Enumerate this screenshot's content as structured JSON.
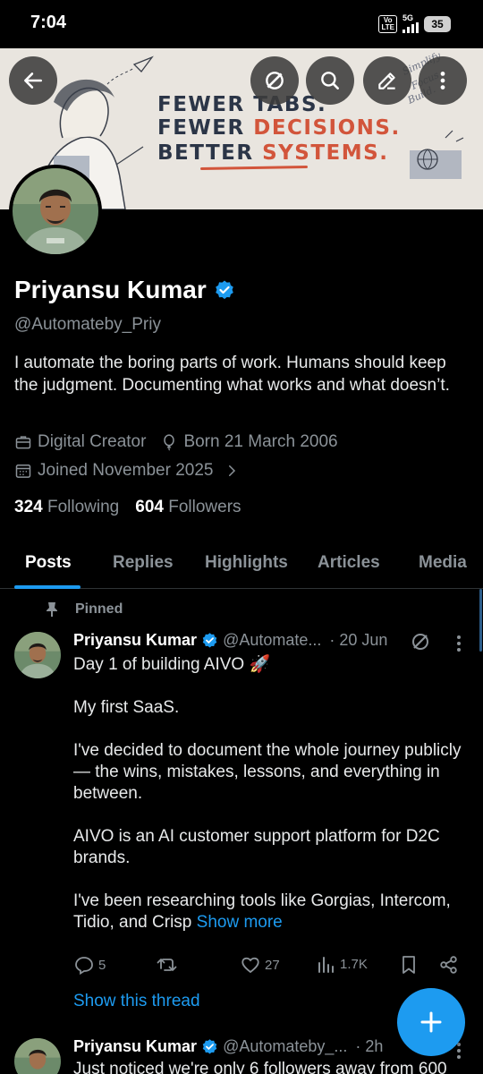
{
  "status_bar": {
    "time": "7:04",
    "volte": "Vo LTE",
    "network": "5G",
    "battery": "35"
  },
  "banner": {
    "line1": "FEWER TABS.",
    "line2_prefix": "FEWER ",
    "line2_accent": "DECISIONS.",
    "line3_prefix": "BETTER ",
    "line3_accent": "SYSTEMS.",
    "accent_color": "#d2553b",
    "icons": [
      "back-arrow-icon",
      "grok-icon",
      "search-icon",
      "edit-icon",
      "more-icon"
    ]
  },
  "profile": {
    "name": "Priyansu Kumar",
    "handle": "@Automateby_Priy",
    "bio": "I automate the boring parts of work. Humans should keep the judgment.  Documenting what works and what doesn’t.",
    "category": "Digital Creator",
    "born": "Born 21 March 2006",
    "joined": "Joined November 2025",
    "following_count": "324",
    "following_label": "Following",
    "followers_count": "604",
    "followers_label": "Followers"
  },
  "tabs": [
    {
      "label": "Posts",
      "active": true
    },
    {
      "label": "Replies"
    },
    {
      "label": "Highlights"
    },
    {
      "label": "Articles"
    },
    {
      "label": "Media"
    }
  ],
  "posts": [
    {
      "pinned_label": "Pinned",
      "author": "Priyansu Kumar",
      "handle": "@Automate...",
      "time": "· 20 Jun",
      "paragraphs": [
        "Day 1 of building AIVO 🚀",
        "My first SaaS.",
        "I've decided to document the whole journey publicly — the wins, mistakes, lessons, and everything in between.",
        "AIVO is an AI customer support platform for D2C brands."
      ],
      "last_paragraph": "I've been researching tools like Gorgias, Intercom, Tidio, and Crisp ",
      "show_more": "Show more",
      "replies": "5",
      "reposts": "",
      "likes": "27",
      "views": "1.7K",
      "show_thread": "Show this thread"
    },
    {
      "author": "Priyansu Kumar",
      "handle": "@Automateby_...",
      "time": "· 2h",
      "text": "Just noticed we're only 6 followers away from 600"
    }
  ],
  "accent_color": "#1d9bf0"
}
